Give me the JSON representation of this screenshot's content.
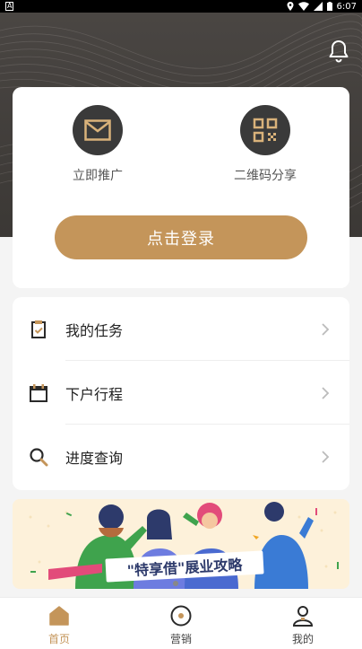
{
  "status_bar": {
    "left_badge": "A",
    "time": "6:07"
  },
  "actions": {
    "promote": {
      "label": "立即推广",
      "icon": "envelope-icon"
    },
    "qrcode": {
      "label": "二维码分享",
      "icon": "qrcode-icon"
    }
  },
  "login_button": {
    "label": "点击登录"
  },
  "menu": {
    "items": [
      {
        "label": "我的任务",
        "icon": "clipboard-check-icon"
      },
      {
        "label": "下户行程",
        "icon": "calendar-icon"
      },
      {
        "label": "进度查询",
        "icon": "search-icon"
      }
    ]
  },
  "banner": {
    "title": "\"特享借\"展业攻略"
  },
  "tabbar": {
    "tabs": [
      {
        "label": "首页",
        "icon": "home-icon",
        "active": true
      },
      {
        "label": "营销",
        "icon": "compass-icon",
        "active": false
      },
      {
        "label": "我的",
        "icon": "user-icon",
        "active": false
      }
    ]
  },
  "colors": {
    "accent": "#c4955a",
    "hero": "#3d3a37",
    "icon_circle": "#3a3a3a",
    "active_tab": "#c4955a"
  }
}
